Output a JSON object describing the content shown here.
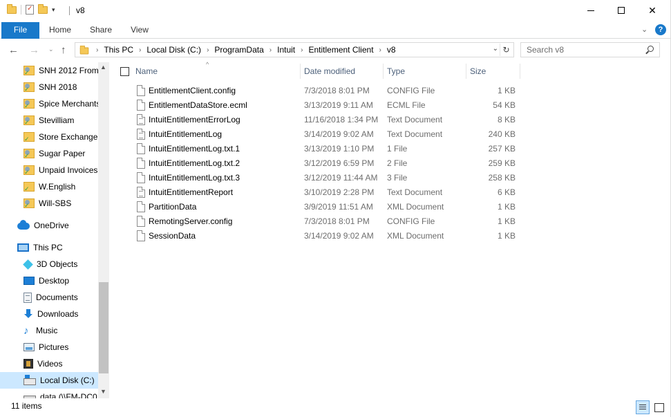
{
  "window": {
    "title": "v8",
    "minimize": "",
    "maximize": "",
    "close": "✕"
  },
  "ribbon": {
    "tabs": [
      "File",
      "Home",
      "Share",
      "View"
    ],
    "help": "?"
  },
  "address": {
    "crumbs": [
      "This PC",
      "Local Disk (C:)",
      "ProgramData",
      "Intuit",
      "Entitlement Client",
      "v8"
    ]
  },
  "search": {
    "placeholder": "Search v8"
  },
  "sidebar": {
    "items": [
      {
        "label": "SNH 2012 From",
        "icon": "qb-folder-icon"
      },
      {
        "label": "SNH 2018",
        "icon": "qb-folder-icon"
      },
      {
        "label": "Spice Merchants",
        "icon": "qb-folder-icon"
      },
      {
        "label": "Stevilliam",
        "icon": "qb-folder-icon"
      },
      {
        "label": "Store Exchange",
        "icon": "folder-icon"
      },
      {
        "label": "Sugar Paper",
        "icon": "qb-folder-icon"
      },
      {
        "label": "Unpaid Invoices",
        "icon": "qb-folder-icon"
      },
      {
        "label": "W.English",
        "icon": "folder-icon"
      },
      {
        "label": "Will-SBS",
        "icon": "qb-folder-icon"
      },
      {
        "label": "OneDrive",
        "icon": "onedrive-icon"
      },
      {
        "label": "This PC",
        "icon": "this-pc-icon"
      },
      {
        "label": "3D Objects",
        "icon": "3d-objects-icon"
      },
      {
        "label": "Desktop",
        "icon": "desktop-icon"
      },
      {
        "label": "Documents",
        "icon": "documents-icon"
      },
      {
        "label": "Downloads",
        "icon": "downloads-icon"
      },
      {
        "label": "Music",
        "icon": "music-icon"
      },
      {
        "label": "Pictures",
        "icon": "pictures-icon"
      },
      {
        "label": "Videos",
        "icon": "videos-icon"
      },
      {
        "label": "Local Disk (C:)",
        "icon": "local-disk-icon",
        "selected": true
      },
      {
        "label": "data (\\\\FM-DC0",
        "icon": "network-drive-icon"
      }
    ]
  },
  "columns": {
    "name": "Name",
    "date": "Date modified",
    "type": "Type",
    "size": "Size"
  },
  "files": [
    {
      "name": "EntitlementClient.config",
      "date": "7/3/2018 8:01 PM",
      "type": "CONFIG File",
      "size": "1 KB",
      "icon": "file-icon"
    },
    {
      "name": "EntitlementDataStore.ecml",
      "date": "3/13/2019 9:11 AM",
      "type": "ECML File",
      "size": "54 KB",
      "icon": "file-icon"
    },
    {
      "name": "IntuitEntitlementErrorLog",
      "date": "11/16/2018 1:34 PM",
      "type": "Text Document",
      "size": "8 KB",
      "icon": "text-file-icon"
    },
    {
      "name": "IntuitEntitlementLog",
      "date": "3/14/2019 9:02 AM",
      "type": "Text Document",
      "size": "240 KB",
      "icon": "text-file-icon"
    },
    {
      "name": "IntuitEntitlementLog.txt.1",
      "date": "3/13/2019 1:10 PM",
      "type": "1 File",
      "size": "257 KB",
      "icon": "file-icon"
    },
    {
      "name": "IntuitEntitlementLog.txt.2",
      "date": "3/12/2019 6:59 PM",
      "type": "2 File",
      "size": "259 KB",
      "icon": "file-icon"
    },
    {
      "name": "IntuitEntitlementLog.txt.3",
      "date": "3/12/2019 11:44 AM",
      "type": "3 File",
      "size": "258 KB",
      "icon": "file-icon"
    },
    {
      "name": "IntuitEntitlementReport",
      "date": "3/10/2019 2:28 PM",
      "type": "Text Document",
      "size": "6 KB",
      "icon": "text-file-icon"
    },
    {
      "name": "PartitionData",
      "date": "3/9/2019 11:51 AM",
      "type": "XML Document",
      "size": "1 KB",
      "icon": "file-icon"
    },
    {
      "name": "RemotingServer.config",
      "date": "7/3/2018 8:01 PM",
      "type": "CONFIG File",
      "size": "1 KB",
      "icon": "file-icon"
    },
    {
      "name": "SessionData",
      "date": "3/14/2019 9:02 AM",
      "type": "XML Document",
      "size": "1 KB",
      "icon": "file-icon"
    }
  ],
  "status": {
    "count": "11 items"
  },
  "colors": {
    "accent": "#1979ca",
    "selection": "#cce8ff",
    "header_text": "#4c607a",
    "muted_text": "#6d6d6d"
  }
}
